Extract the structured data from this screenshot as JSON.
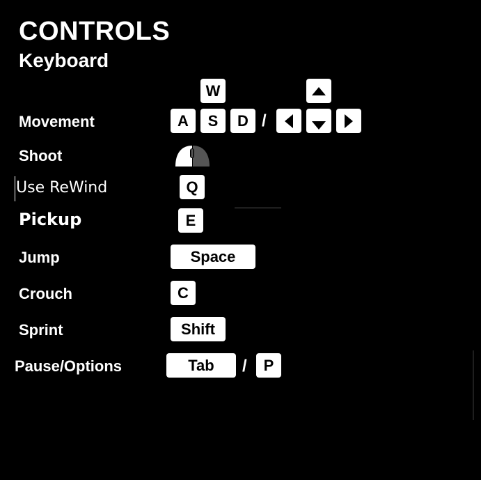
{
  "header": {
    "title": "CONTROLS",
    "subtitle": "Keyboard"
  },
  "controls": {
    "movement": {
      "label": "Movement",
      "keys": [
        "W",
        "A",
        "S",
        "D"
      ],
      "separator": "/",
      "arrow_icons": [
        "arrow-up-icon",
        "arrow-left-icon",
        "arrow-down-icon",
        "arrow-right-icon"
      ]
    },
    "shoot": {
      "label": "Shoot",
      "icon": "mouse-left-click-icon"
    },
    "rewind": {
      "label": "Use ReWind",
      "key": "Q"
    },
    "pickup": {
      "label": "Pickup",
      "key": "E"
    },
    "jump": {
      "label": "Jump",
      "key": "Space"
    },
    "crouch": {
      "label": "Crouch",
      "key": "C"
    },
    "sprint": {
      "label": "Sprint",
      "key": "Shift"
    },
    "pause": {
      "label": "Pause/Options",
      "keys": [
        "Tab",
        "P"
      ],
      "separator": "/"
    }
  },
  "colors": {
    "background": "#000000",
    "text": "#ffffff",
    "keycap": "#ffffff",
    "keycap_text": "#000000"
  }
}
